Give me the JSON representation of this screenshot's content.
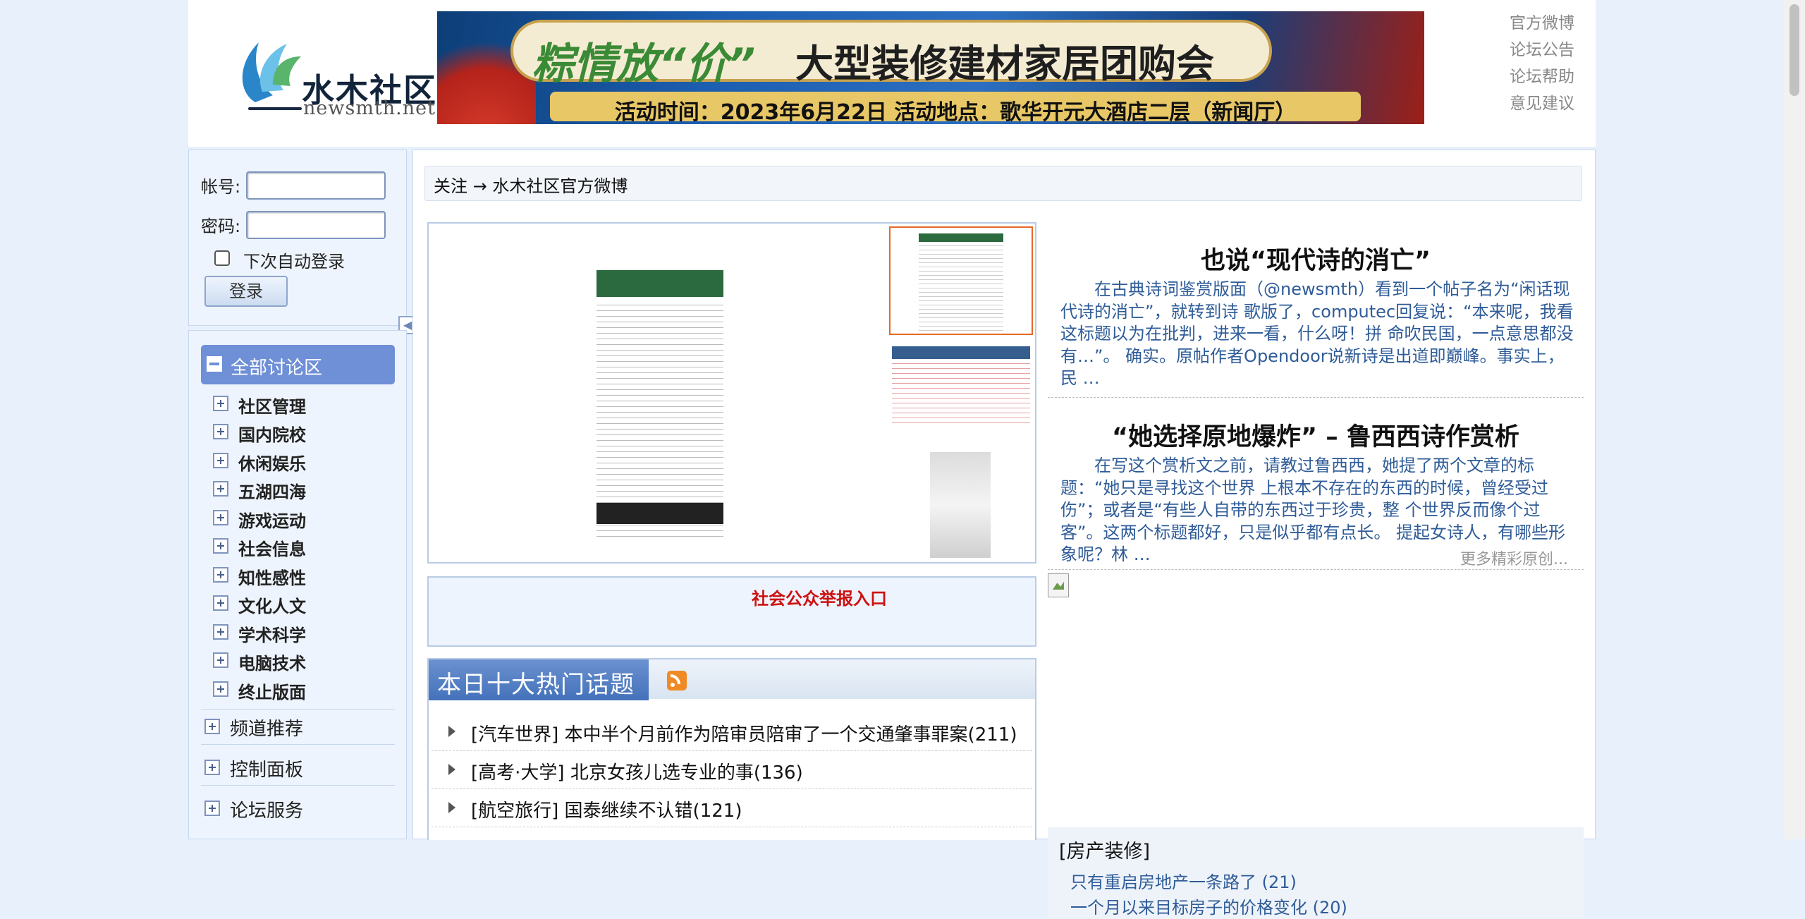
{
  "logo": {
    "name": "水木社区",
    "domain": "newsmth.net"
  },
  "banner": {
    "slogan": "粽情放“价”",
    "title": "大型装修建材家居团购会",
    "details": "活动时间：2023年6月22日    活动地点：歌华开元大酒店二层（新闻厅）"
  },
  "top_links": [
    "官方微博",
    "论坛公告",
    "论坛帮助",
    "意见建议"
  ],
  "login": {
    "account_label": "帐号:",
    "password_label": "密码:",
    "remember_label": "下次自动登录",
    "login_button": "登录"
  },
  "nav": {
    "all_sections": "全部讨论区",
    "sections": [
      "社区管理",
      "国内院校",
      "休闲娱乐",
      "五湖四海",
      "游戏运动",
      "社会信息",
      "知性感性",
      "文化人文",
      "学术科学",
      "电脑技术",
      "终止版面"
    ],
    "extra": [
      "频道推荐",
      "控制面板",
      "论坛服务"
    ]
  },
  "breadcrumb": "关注 → 水木社区官方微博",
  "report_link": "社会公众举报入口",
  "hot_topics": {
    "title": "本日十大热门话题",
    "items": [
      "[汽车世界] 本中半个月前作为陪审员陪审了一个交通肇事罪案(211)",
      "[高考·大学] 北京女孩儿选专业的事(136)",
      "[航空旅行] 国泰继续不认错(121)"
    ]
  },
  "articles": [
    {
      "title": "也说“现代诗的消亡”",
      "body": "在古典诗词鉴赏版面（@newsmth）看到一个帖子名为“闲话现代诗的消亡”，就转到诗 歌版了，computec回复说：“本来呢，我看这标题以为在批判，进来一看，什么呀！拼 命吹民国，一点意思都没有…”。 确实。原帖作者Opendoor说新诗是出道即巅峰。事实上，民 …"
    },
    {
      "title": "“她选择原地爆炸” – 鲁西西诗作赏析",
      "body": "在写这个赏析文之前，请教过鲁西西，她提了两个文章的标题：“她只是寻找这个世界 上根本不存在的东西的时候，曾经受过伤”；或者是“有些人自带的东西过于珍贵，整 个世界反而像个过客”。这两个标题都好，只是似乎都有点长。 提起女诗人，有哪些形象呢？林 …"
    }
  ],
  "more_link": "更多精彩原创...",
  "board": {
    "title": "[房产装修]",
    "items": [
      "只有重启房地产一条路了 (21)",
      "一个月以来目标房子的价格变化 (20)"
    ]
  }
}
